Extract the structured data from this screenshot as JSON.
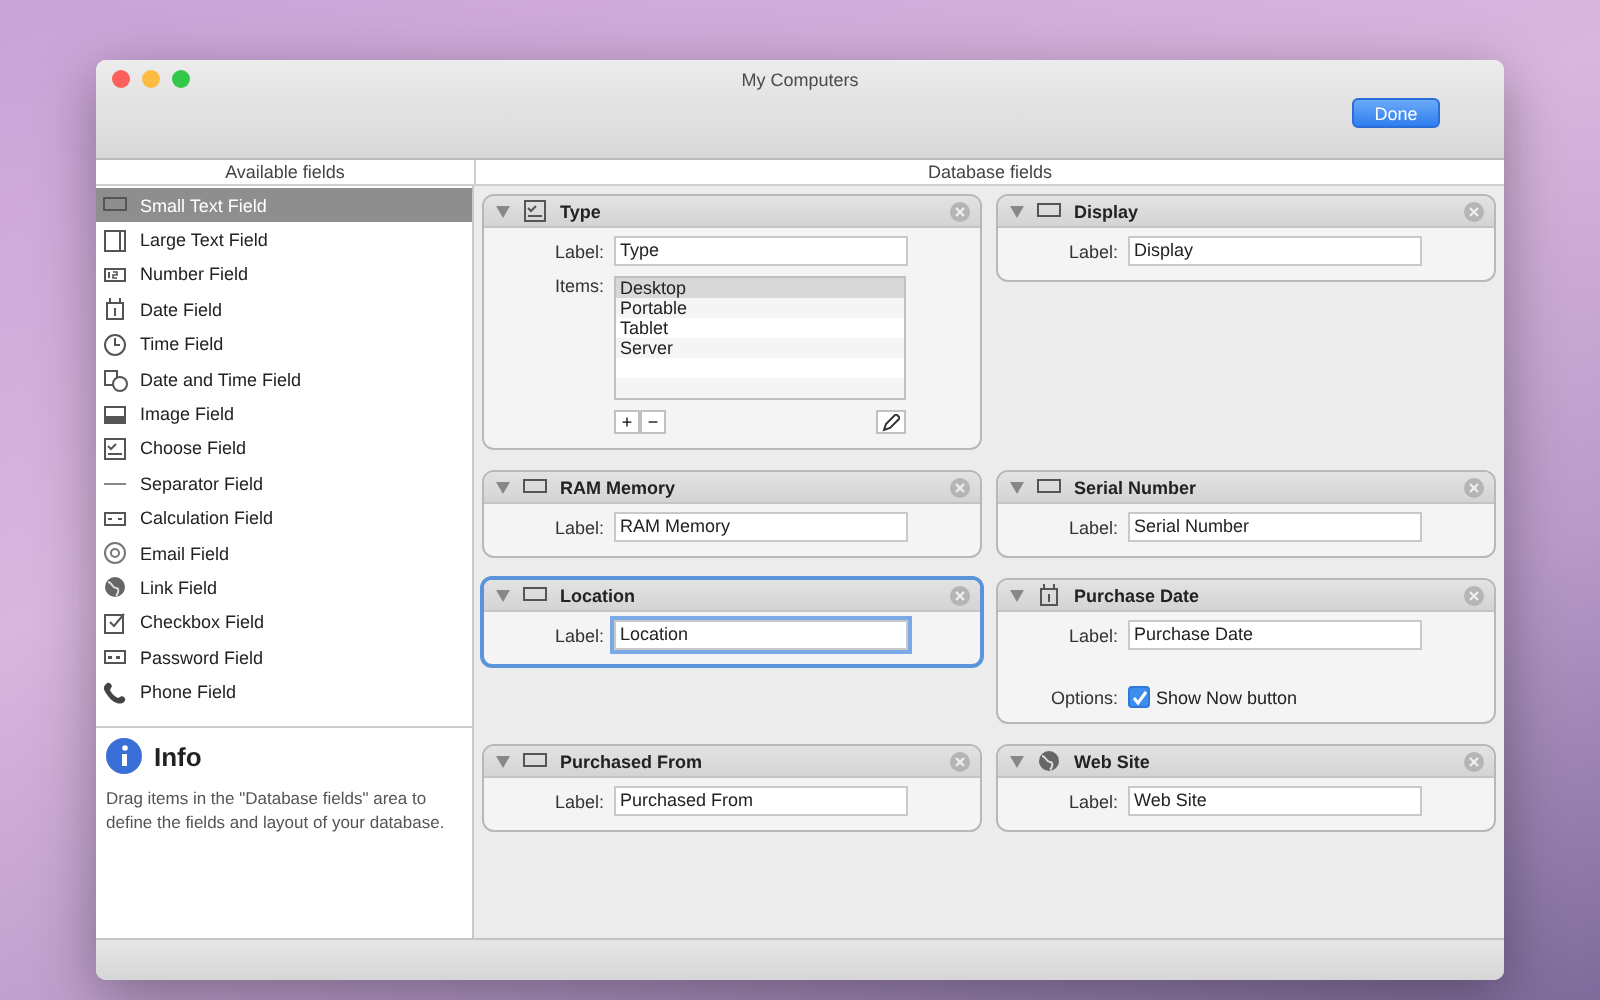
{
  "window": {
    "title": "My Computers"
  },
  "toolbar": {
    "done_button": "Done"
  },
  "column_headers": {
    "left": "Available fields",
    "right": "Database fields"
  },
  "sidebar": {
    "items": [
      {
        "label": "Small Text Field",
        "selected": true
      },
      {
        "label": "Large Text Field",
        "selected": false
      },
      {
        "label": "Number Field",
        "selected": false
      },
      {
        "label": "Date Field",
        "selected": false
      },
      {
        "label": "Time Field",
        "selected": false
      },
      {
        "label": "Date and Time Field",
        "selected": false
      },
      {
        "label": "Image Field",
        "selected": false
      },
      {
        "label": "Choose Field",
        "selected": false
      },
      {
        "label": "Separator Field",
        "selected": false
      },
      {
        "label": "Calculation Field",
        "selected": false
      },
      {
        "label": "Email Field",
        "selected": false
      },
      {
        "label": "Link Field",
        "selected": false
      },
      {
        "label": "Checkbox Field",
        "selected": false
      },
      {
        "label": "Password Field",
        "selected": false
      },
      {
        "label": "Phone Field",
        "selected": false
      }
    ],
    "info": {
      "title": "Info",
      "text": "Drag items in the \"Database fields\" area to define the fields and layout of your database."
    }
  },
  "cards": [
    {
      "kind": "choose",
      "title": "Type",
      "selected": false,
      "label_caption": "Label:",
      "label_value": "Type",
      "items_caption": "Items:",
      "items": [
        {
          "text": "Desktop",
          "selected": true
        },
        {
          "text": "Portable",
          "selected": false
        },
        {
          "text": "Tablet",
          "selected": false
        },
        {
          "text": "Server",
          "selected": false
        }
      ],
      "add_button": "+",
      "remove_button": "−"
    },
    {
      "kind": "text",
      "title": "Display",
      "selected": false,
      "label_caption": "Label:",
      "label_value": "Display"
    },
    {
      "kind": "text",
      "title": "RAM Memory",
      "selected": false,
      "label_caption": "Label:",
      "label_value": "RAM Memory"
    },
    {
      "kind": "text",
      "title": "Serial Number",
      "selected": false,
      "label_caption": "Label:",
      "label_value": "Serial Number"
    },
    {
      "kind": "text",
      "title": "Location",
      "selected": true,
      "label_caption": "Label:",
      "label_value": "Location"
    },
    {
      "kind": "date",
      "title": "Purchase Date",
      "selected": false,
      "label_caption": "Label:",
      "label_value": "Purchase Date",
      "options_caption": "Options:",
      "option": {
        "label": "Show Now button",
        "checked": true
      }
    },
    {
      "kind": "text",
      "title": "Purchased From",
      "selected": false,
      "label_caption": "Label:",
      "label_value": "Purchased From"
    },
    {
      "kind": "link",
      "title": "Web Site",
      "selected": false,
      "label_caption": "Label:",
      "label_value": "Web Site"
    }
  ]
}
